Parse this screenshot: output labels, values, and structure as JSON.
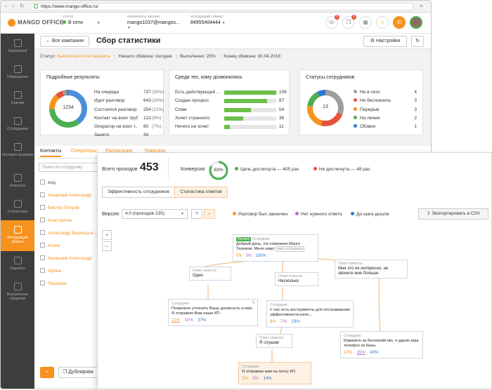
{
  "browser": {
    "url": "https://www.mango-office.ru/"
  },
  "header": {
    "logo_text": "MANGO OFFICE",
    "status_label": "статус",
    "status_value": "В сети",
    "incoming_label": "принимать звонки",
    "incoming_value": "mango1037@mangos...",
    "outgoing_label": "исходящий номер",
    "outgoing_value": "84955404444",
    "badges": [
      "5",
      "2"
    ]
  },
  "sidebar": [
    {
      "label": "Dashboard",
      "icon": "dashboard-icon"
    },
    {
      "label": "Обращения",
      "icon": "mail-icon"
    },
    {
      "label": "Сделки",
      "icon": "deals-icon"
    },
    {
      "label": "Сотрудники",
      "icon": "users-icon"
    },
    {
      "label": "История вызовов",
      "icon": "history-icon"
    },
    {
      "label": "Клиенты",
      "icon": "clients-icon"
    },
    {
      "label": "Статистика",
      "icon": "stats-icon"
    },
    {
      "label": "Исходящий обзвон",
      "icon": "octopus-icon"
    },
    {
      "label": "Скрипты",
      "icon": "scripts-icon"
    },
    {
      "label": "Внутренние общение",
      "icon": "chat-icon"
    }
  ],
  "toolbar": {
    "back_label": "Все кампании",
    "title": "Сбор статистики",
    "settings_label": "Настройки"
  },
  "status_bar": {
    "status_prefix": "Статус:",
    "status_value": "Выполняется остановить",
    "start": "Начало обзвона: сегодня",
    "done": "Выполнено: 25%",
    "end": "Конец обзвона: 30.04.2018"
  },
  "detailed": {
    "title": "Подробные результаты",
    "total": "1234",
    "rows": [
      {
        "label": "На очереди",
        "value": "737",
        "pct": "(30%)",
        "color": "#4a90d9"
      },
      {
        "label": "Идет разговор",
        "value": "643",
        "pct": "(20%)",
        "color": "#4caf50"
      },
      {
        "label": "Состоялся разговор",
        "value": "254",
        "pct": "(12%)",
        "color": "#f7921e"
      },
      {
        "label": "Контакт на взял труб...",
        "value": "122",
        "pct": "(8%)",
        "color": "#e5533a"
      },
      {
        "label": "Оператор на взял т...",
        "value": "60",
        "pct": "(7%)",
        "color": "#9e9e9e"
      },
      {
        "label": "Занято",
        "value": "34",
        "pct": "",
        "color": "#777"
      }
    ]
  },
  "reached": {
    "title": "Среди тех, кому дозвонились",
    "rows": [
      {
        "label": "Есть действующий ...",
        "value": "106"
      },
      {
        "label": "Создан процесс",
        "value": "87"
      },
      {
        "label": "Спам",
        "value": "54"
      },
      {
        "label": "Хочет странного",
        "value": "38"
      },
      {
        "label": "Ничего не хочет",
        "value": "11"
      }
    ]
  },
  "employees_status": {
    "title": "Статусы сотрудников",
    "total": "13",
    "rows": [
      {
        "label": "Не в сети",
        "value": "4",
        "color": "#9e9e9e"
      },
      {
        "label": "Не беспокоить",
        "value": "3",
        "color": "#e5533a"
      },
      {
        "label": "Перерыв",
        "value": "3",
        "color": "#f7921e"
      },
      {
        "label": "На линии",
        "value": "2",
        "color": "#4caf50"
      },
      {
        "label": "Обзвон",
        "value": "1",
        "color": "#2b7bd3"
      }
    ]
  },
  "tabs": [
    "Контакты",
    "Операторы",
    "Расписание",
    "Тематики"
  ],
  "contacts": {
    "search_placeholder": "Поиск по сотруднику",
    "items": [
      "вид",
      "Казанцев Александр",
      "Виктор Петров",
      "Константин",
      "Александр Верещаги...",
      "Юлия",
      "Казанцев Александр",
      "Ирина",
      "Перерва"
    ],
    "duplicate_label": "Дублирова"
  },
  "panel": {
    "total_label": "Всего проходов",
    "total_value": "453",
    "conv_label": "Конверсия",
    "conv_value": "83%",
    "conv_fraction": 0.83,
    "goal_yes": "Цель достигнута — 405 раз",
    "goal_no": "Не достигнута — 48 раз",
    "tab1": "Эффективность сотрудников",
    "tab2": "Статистика ответов",
    "version_label": "Версия:",
    "version_value": "4.0 (проходов 235)",
    "leg1": "Разговор был закончен",
    "leg2": "Нет нужного ответа",
    "leg3": "До шага дошли",
    "export_label": "Экспортировать в CSV"
  },
  "flow": {
    "start": {
      "tag": "Начало",
      "who": "Сотрудник:",
      "text": "Добрый день, это компания Манго Телеком. Меня зовут",
      "tagvar": "имя сотрудника",
      "p1": "0%",
      "p2": "0%",
      "p3": "100%"
    },
    "c1": {
      "who": "Ответ клиента:",
      "text": "Один"
    },
    "c2": {
      "who": "Ответ клиента:",
      "text": "Несколько"
    },
    "c3": {
      "who": "Ответ клиента:",
      "text": "Мне это не интересно, не звоните мне больше"
    },
    "e1": {
      "who": "Сотрудник:",
      "text": "Позвольте уточнить Вашу должность и имя. Я отправлю Вам наше КП.",
      "p1": "21%",
      "p2": "10%",
      "p3": "37%"
    },
    "e2": {
      "who": "Сотрудник:",
      "text": "У нас есть инструменты для отслеживания эффективности рекл...",
      "p1": "8%",
      "p2": "7%",
      "p3": "23%"
    },
    "c4": {
      "who": "Ответ клиента:",
      "text": "Я слушаю"
    },
    "e3": {
      "who": "Сотрудник:",
      "text": "Извините за беспокойство, я удалю ваш телефон из базы.",
      "p1": "10%",
      "p2": "35%",
      "p3": "40%"
    },
    "e4": {
      "who": "Сотрудник:",
      "text": "Я отправлю вам на почту КП.",
      "p1": "3%",
      "p2": "5%",
      "p3": "14%"
    }
  }
}
